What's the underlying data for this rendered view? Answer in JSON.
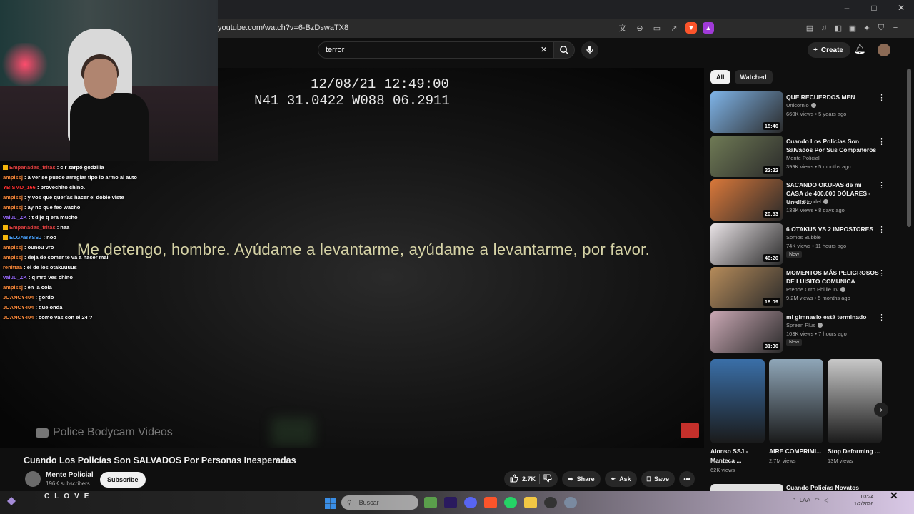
{
  "browser": {
    "url": "youtube.com/watch?v=6-BzDswaTX8",
    "window_controls": [
      "–",
      "□",
      "✕"
    ]
  },
  "header": {
    "search_query": "terror",
    "create_label": "Create"
  },
  "player": {
    "timestamp_line1": "12/08/21 12:49:00",
    "timestamp_line2": "N41 31.0422 W088 06.2911",
    "subtitle": "Me detengo, hombre. Ayúdame a levantarme, ayúdame a levantarme, por favor.",
    "watermark": "Police Bodycam Videos"
  },
  "video": {
    "title": "Cuando Los Policías Son SALVADOS Por Personas Inesperadas",
    "channel": "Mente Policial",
    "subscribers": "196K subscribers",
    "subscribe_label": "Subscribe",
    "likes": "2.7K",
    "share_label": "Share",
    "ask_label": "Ask",
    "save_label": "Save"
  },
  "sidebar": {
    "chips": [
      "All",
      "Watched"
    ],
    "recommendations": [
      {
        "title": "QUE RECUERDOS MEN",
        "channel": "Unicornio",
        "verified": true,
        "meta": "660K views • 5 years ago",
        "duration": "15:40",
        "new": false,
        "color": "#7fb4e8"
      },
      {
        "title": "Cuando Los Policías Son Salvados Por Sus Compañeros",
        "channel": "Mente Policial",
        "verified": false,
        "meta": "399K views • 5 months ago",
        "duration": "22:22",
        "new": false,
        "color": "#6f7a55"
      },
      {
        "title": "SACANDO OKUPAS de mi CASA de 400.000 DÓLARES - Un día ...",
        "channel": "Mauro Stendel",
        "verified": true,
        "meta": "133K views • 8 days ago",
        "duration": "20:53",
        "new": false,
        "color": "#d9783a"
      },
      {
        "title": "6 OTAKUS VS 2 IMPOSTORES",
        "channel": "Somos Bubble",
        "verified": false,
        "meta": "74K views • 11 hours ago",
        "duration": "46:20",
        "new": true,
        "color": "#e9e3e6"
      },
      {
        "title": "MOMENTOS MÁS PELIGROSOS DE LUISITO COMUNICA",
        "channel": "Prende Otro Phillie Tv",
        "verified": true,
        "meta": "9.2M views • 5 months ago",
        "duration": "18:09",
        "new": false,
        "color": "#b58b5a"
      },
      {
        "title": "mi gimnasio está terminado",
        "channel": "Spreen Plus",
        "verified": true,
        "meta": "103K views • 7 hours ago",
        "duration": "31:30",
        "new": true,
        "color": "#c9a7b3"
      }
    ],
    "new_label": "New",
    "shorts": [
      {
        "title": "Alonso SSJ - Manteca ...",
        "views": "62K views",
        "color": "#3a6fa8"
      },
      {
        "title": "AIRE COMPRIMI...",
        "views": "2.7M views",
        "color": "#8fa6b8"
      },
      {
        "title": "Stop Deforming ...",
        "views": "13M views",
        "color": "#c8c8c8"
      }
    ],
    "partial_title": "Cuando Policías Novatos"
  },
  "stream": {
    "brand": "CLOVE",
    "chat": [
      {
        "user": "Empanadas_fritas",
        "msg": "c r zarpó godzilla",
        "color": "#e04040",
        "badge": true
      },
      {
        "user": "ampissj",
        "msg": "a ver se puede arreglar tipo lo armo al auto",
        "color": "#ff8c3b",
        "badge": false
      },
      {
        "user": "YBISMD_166",
        "msg": "provechito chino.",
        "color": "#ff3030",
        "badge": false
      },
      {
        "user": "ampissj",
        "msg": "y vos que querías hacer el doble viste",
        "color": "#ff8c3b",
        "badge": false
      },
      {
        "user": "ampissj",
        "msg": "ay no que feo wacho",
        "color": "#ff8c3b",
        "badge": false
      },
      {
        "user": "valuu_ZK",
        "msg": "t dije q era mucho",
        "color": "#9b6bff",
        "badge": false
      },
      {
        "user": "Empanadas_fritas",
        "msg": "naa",
        "color": "#e04040",
        "badge": true
      },
      {
        "user": "ELGABYSSJ",
        "msg": "noo",
        "color": "#4aa3ff",
        "badge": true
      },
      {
        "user": "ampissj",
        "msg": "ounou vro",
        "color": "#ff8c3b",
        "badge": false
      },
      {
        "user": "ampissj",
        "msg": "deja de comer te va a hacer mal",
        "color": "#ff8c3b",
        "badge": false
      },
      {
        "user": "renittaa",
        "msg": "el de los otakuuuus",
        "color": "#ff8c3b",
        "badge": false
      },
      {
        "user": "valuu_ZK",
        "msg": "q mrd ves chino",
        "color": "#9b6bff",
        "badge": false
      },
      {
        "user": "ampissj",
        "msg": "en la cola",
        "color": "#ff8c3b",
        "badge": false
      },
      {
        "user": "JUANCY404",
        "msg": "gordo",
        "color": "#ff8c3b",
        "badge": false
      },
      {
        "user": "JUANCY404",
        "msg": "que onda",
        "color": "#ff8c3b",
        "badge": false
      },
      {
        "user": "JUANCY404",
        "msg": "como vas con el 24 ?",
        "color": "#ff8c3b",
        "badge": false
      }
    ]
  },
  "taskbar": {
    "search_placeholder": "Buscar",
    "time": "03:24",
    "date": "1/2/2026",
    "lang": "LAA"
  }
}
